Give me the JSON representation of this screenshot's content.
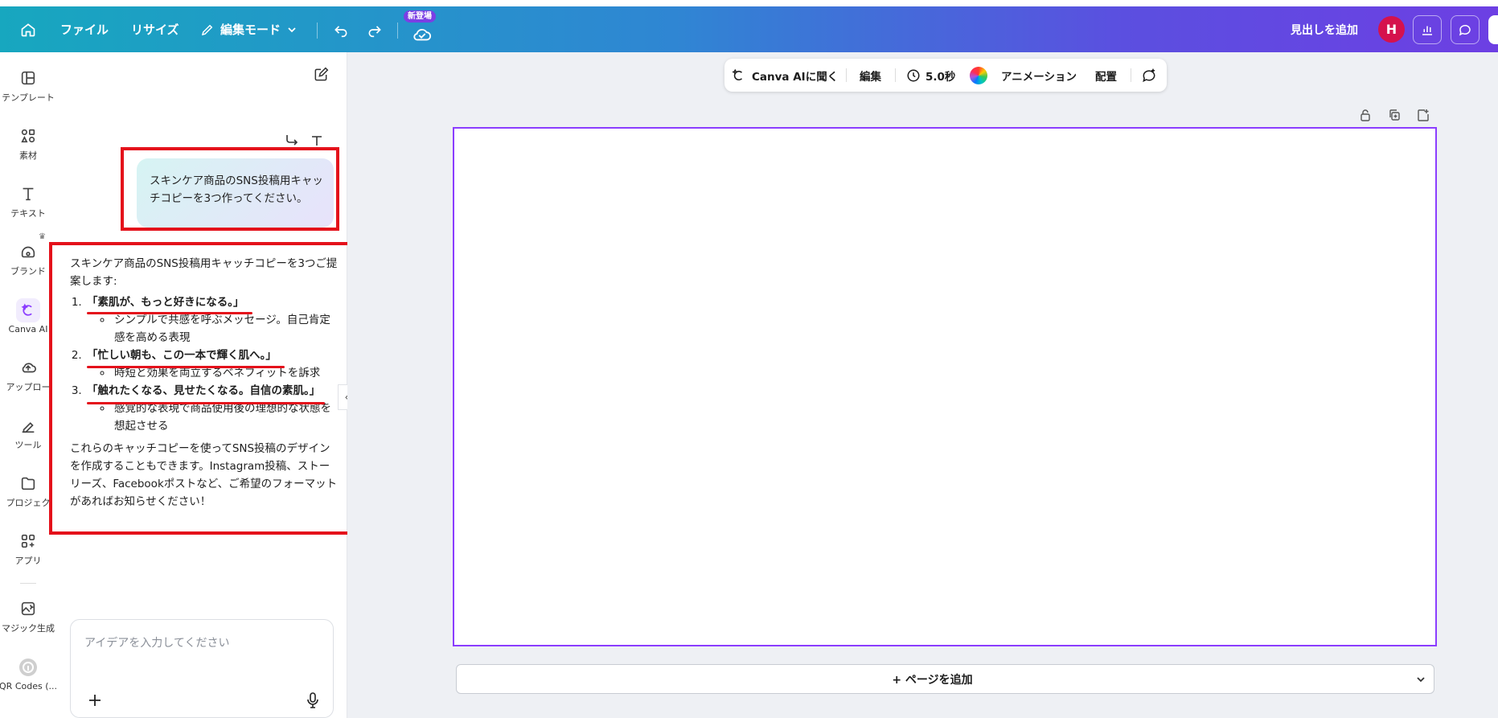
{
  "topbar": {
    "file": "ファイル",
    "resize": "リサイズ",
    "edit_mode": "編集モード",
    "new_badge": "新登場",
    "add_heading": "見出しを追加",
    "avatar_initial": "H"
  },
  "leftnav": {
    "items": [
      {
        "label": "テンプレート",
        "icon": "template-icon"
      },
      {
        "label": "素材",
        "icon": "elements-icon"
      },
      {
        "label": "テキスト",
        "icon": "text-icon"
      },
      {
        "label": "ブランド",
        "icon": "brand-icon"
      },
      {
        "label": "Canva AI",
        "icon": "canva-ai-icon"
      },
      {
        "label": "アップロー",
        "icon": "upload-icon"
      },
      {
        "label": "ツール",
        "icon": "tools-icon"
      },
      {
        "label": "プロジェク",
        "icon": "projects-icon"
      },
      {
        "label": "アプリ",
        "icon": "apps-icon"
      },
      {
        "label": "マジック生成",
        "icon": "magic-generate-icon"
      },
      {
        "label": "QR Codes (...",
        "icon": "qr-codes-icon"
      }
    ]
  },
  "chat": {
    "user_message": "スキンケア商品のSNS投稿用キャッチコピーを3つ作ってください。",
    "ai_intro": "スキンケア商品のSNS投稿用キャッチコピーを3つご提案します:",
    "suggestions": [
      {
        "title": "「素肌が、もっと好きになる。」",
        "note": "シンプルで共感を呼ぶメッセージ。自己肯定感を高める表現"
      },
      {
        "title": "「忙しい朝も、この一本で輝く肌へ。」",
        "note": "時短と効果を両立するベネフィットを訴求"
      },
      {
        "title": "「触れたくなる、見せたくなる。自信の素肌。」",
        "note": "感覚的な表現で商品使用後の理想的な状態を想起させる"
      }
    ],
    "ai_outro": "これらのキャッチコピーを使ってSNS投稿のデザインを作成することもできます。Instagram投稿、ストーリーズ、Facebookポストなど、ご希望のフォーマットがあればお知らせください！",
    "input_placeholder": "アイデアを入力してください"
  },
  "context_toolbar": {
    "ask_ai": "Canva AIに聞く",
    "edit": "編集",
    "duration": "5.0秒",
    "animation": "アニメーション",
    "position": "配置"
  },
  "canvas": {
    "add_page": "+ ページを追加"
  },
  "colors": {
    "accent": "#8b3dff",
    "annotation_red": "#e4111b",
    "avatar": "#d5124d"
  }
}
